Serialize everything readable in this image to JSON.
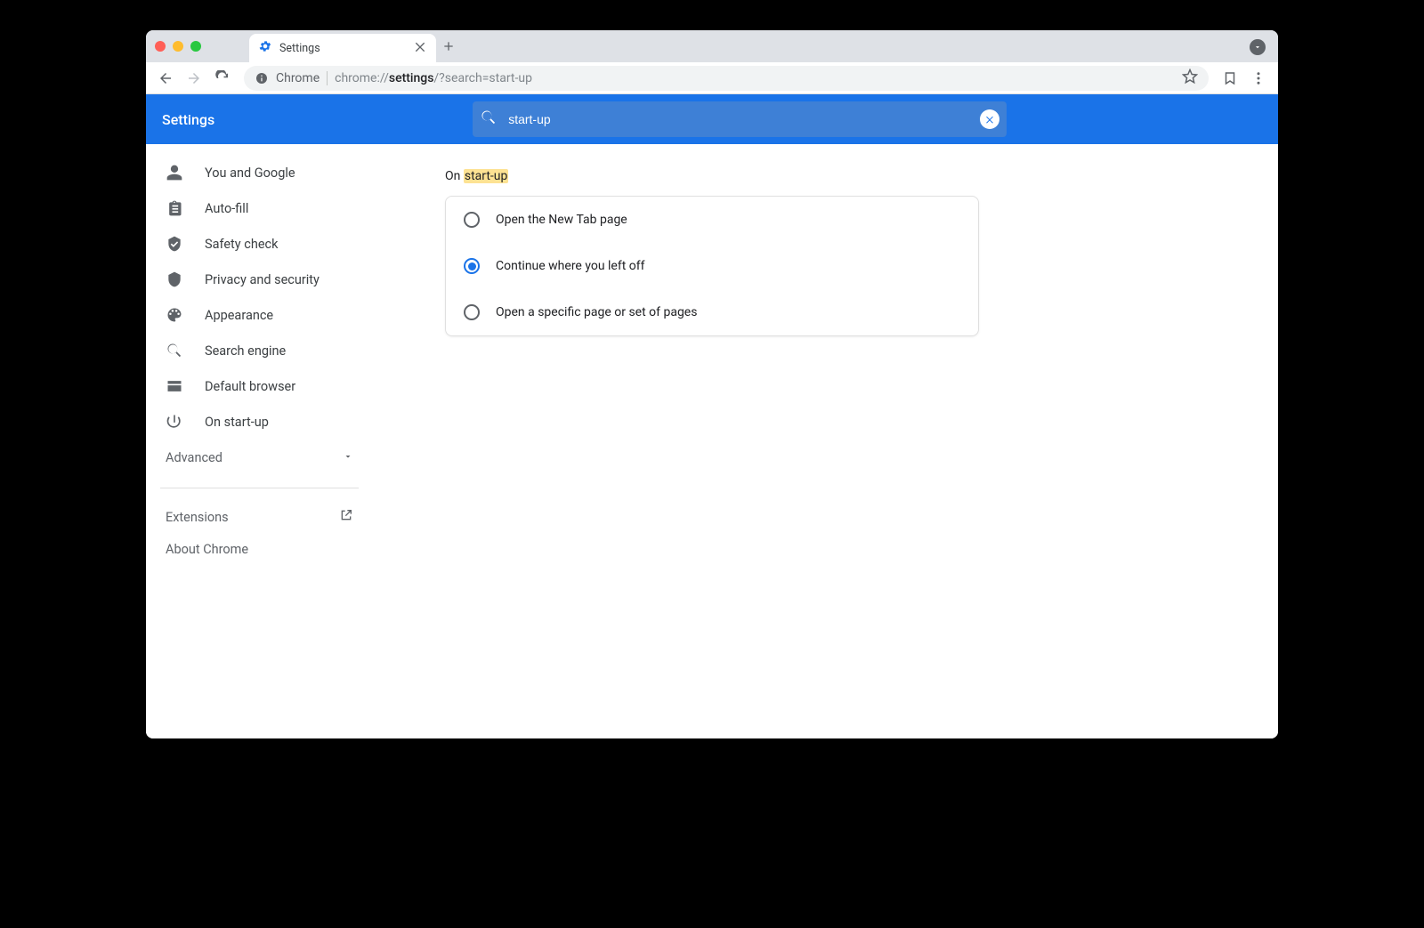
{
  "tab": {
    "title": "Settings"
  },
  "toolbar": {
    "origin_label": "Chrome",
    "url_prefix": "chrome://",
    "url_bold": "settings",
    "url_rest": "/?search=start-up"
  },
  "header": {
    "title": "Settings",
    "search_value": "start-up"
  },
  "sidebar": {
    "items": [
      {
        "label": "You and Google"
      },
      {
        "label": "Auto-fill"
      },
      {
        "label": "Safety check"
      },
      {
        "label": "Privacy and security"
      },
      {
        "label": "Appearance"
      },
      {
        "label": "Search engine"
      },
      {
        "label": "Default browser"
      },
      {
        "label": "On start-up"
      }
    ],
    "advanced_label": "Advanced",
    "extensions_label": "Extensions",
    "about_label": "About Chrome"
  },
  "main": {
    "section_prefix": "On ",
    "section_highlight": "start-up",
    "options": [
      {
        "label": "Open the New Tab page",
        "selected": false
      },
      {
        "label": "Continue where you left off",
        "selected": true
      },
      {
        "label": "Open a specific page or set of pages",
        "selected": false
      }
    ]
  }
}
